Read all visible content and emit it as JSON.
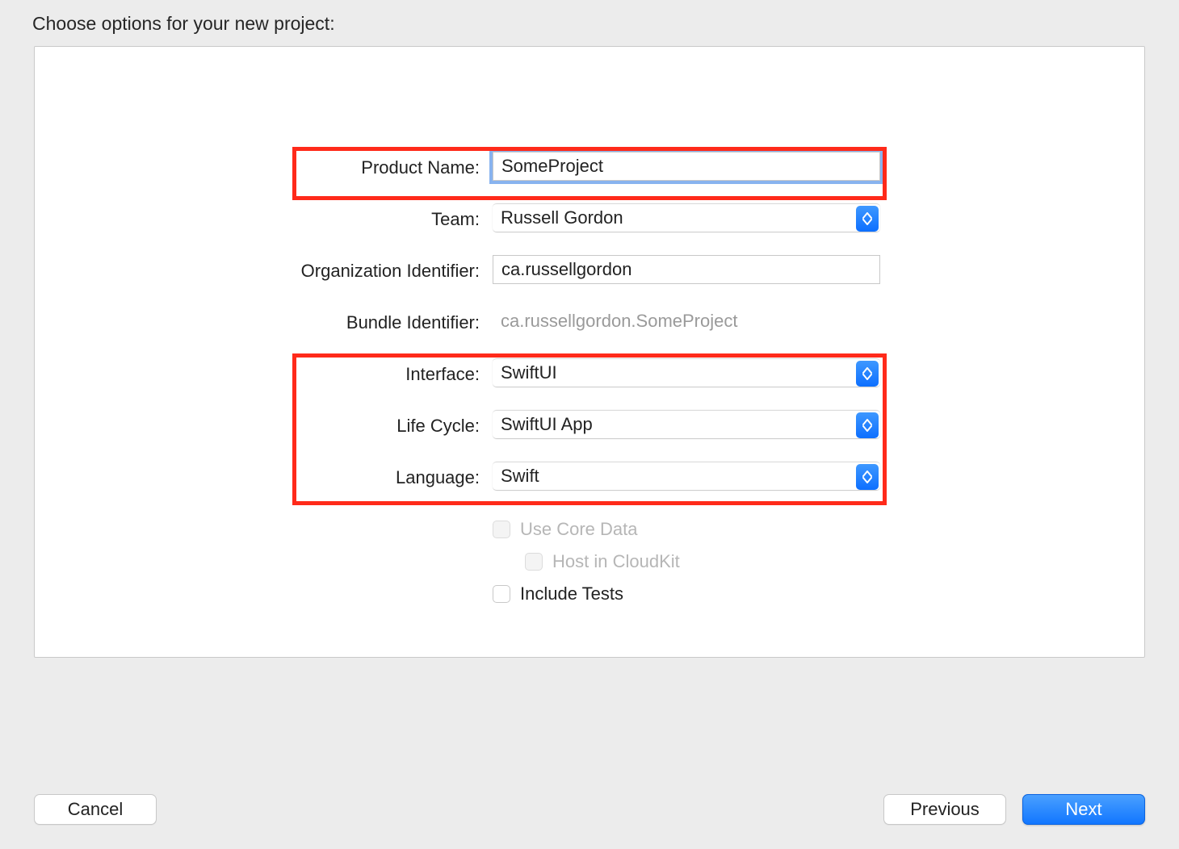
{
  "header": {
    "title": "Choose options for your new project:"
  },
  "form": {
    "product_name": {
      "label": "Product Name:",
      "value": "SomeProject"
    },
    "team": {
      "label": "Team:",
      "value": "Russell Gordon"
    },
    "org_id": {
      "label": "Organization Identifier:",
      "value": "ca.russellgordon"
    },
    "bundle_id": {
      "label": "Bundle Identifier:",
      "value": "ca.russellgordon.SomeProject"
    },
    "interface": {
      "label": "Interface:",
      "value": "SwiftUI"
    },
    "life_cycle": {
      "label": "Life Cycle:",
      "value": "SwiftUI App"
    },
    "language": {
      "label": "Language:",
      "value": "Swift"
    },
    "use_core_data": {
      "label": "Use Core Data",
      "checked": false,
      "disabled": true
    },
    "host_in_cloudkit": {
      "label": "Host in CloudKit",
      "checked": false,
      "disabled": true
    },
    "include_tests": {
      "label": "Include Tests",
      "checked": false,
      "disabled": false
    }
  },
  "footer": {
    "cancel": "Cancel",
    "previous": "Previous",
    "next": "Next"
  }
}
